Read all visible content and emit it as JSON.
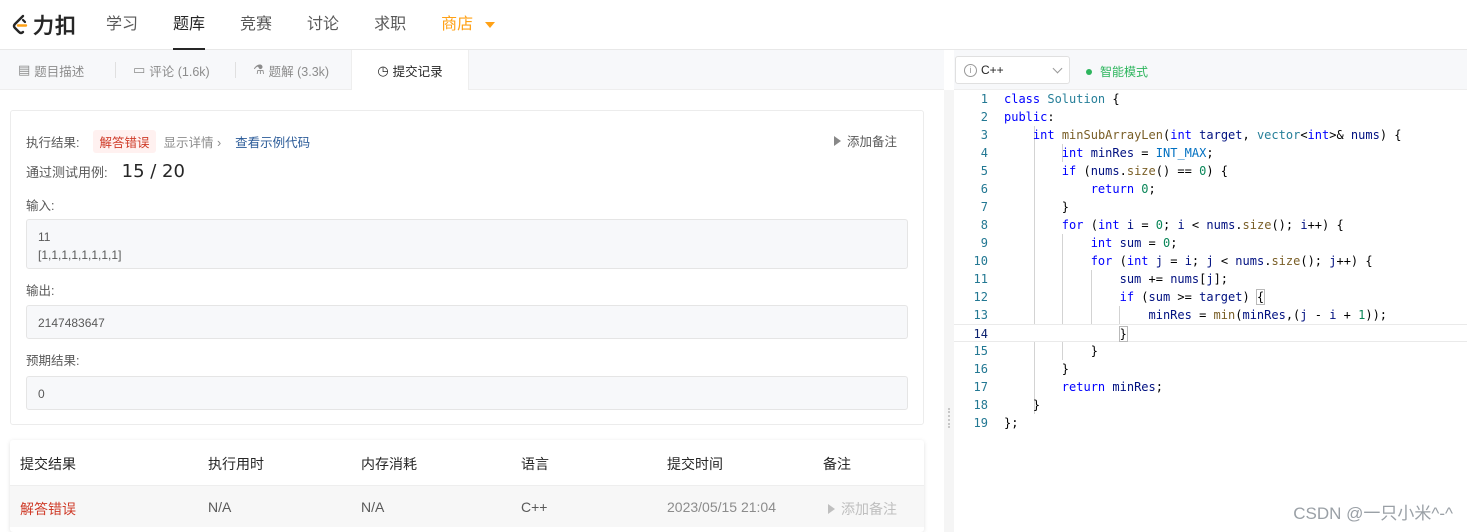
{
  "nav": {
    "logo_text": "力扣",
    "items": [
      "学习",
      "题库",
      "竞赛",
      "讨论",
      "求职"
    ],
    "shop": "商店"
  },
  "tabs": {
    "desc": "题目描述",
    "comments": "评论 (1.6k)",
    "solutions": "题解 (3.3k)",
    "submissions": "提交记录"
  },
  "editor_toolbar": {
    "language": "C++",
    "smart_mode": "智能模式"
  },
  "result": {
    "exec_label": "执行结果:",
    "status": "解答错误",
    "show_details": "显示详情 ›",
    "view_example": "查看示例代码",
    "add_note": "添加备注",
    "passed_label": "通过测试用例:",
    "passed": "15 / 20",
    "input_label": "输入:",
    "input_line1": "11",
    "input_line2": "[1,1,1,1,1,1,1,1]",
    "output_label": "输出:",
    "output": "2147483647",
    "expected_label": "预期结果:",
    "expected": "0"
  },
  "table": {
    "headers": [
      "提交结果",
      "执行用时",
      "内存消耗",
      "语言",
      "提交时间",
      "备注"
    ],
    "row": {
      "result": "解答错误",
      "runtime": "N/A",
      "memory": "N/A",
      "language": "C++",
      "time": "2023/05/15 21:04",
      "note": "添加备注"
    }
  },
  "code": {
    "line_numbers": [
      "1",
      "2",
      "3",
      "4",
      "5",
      "6",
      "7",
      "8",
      "9",
      "10",
      "11",
      "12",
      "13",
      "14",
      "15",
      "16",
      "17",
      "18",
      "19"
    ],
    "current_line": 14
  },
  "watermark": "CSDN @一只小米^-^",
  "colors": {
    "accent": "#ffa116",
    "error": "#cf3b28",
    "link": "#2b5b98",
    "success": "#2db55d"
  }
}
